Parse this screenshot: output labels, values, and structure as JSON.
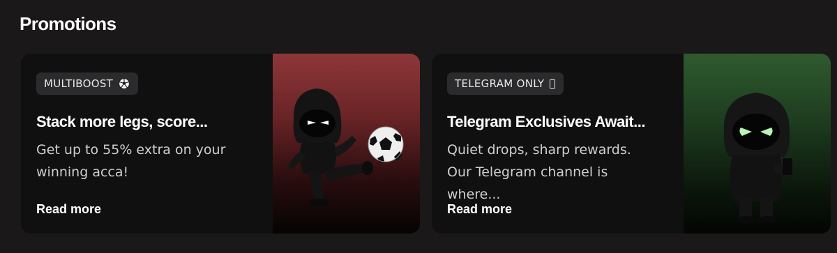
{
  "section": {
    "title": "Promotions"
  },
  "cards": [
    {
      "badge": "MULTIBOOST",
      "badge_icon": "soccer-ball-icon",
      "title": "Stack more legs, score...",
      "description": "Get up to 55% extra on your winning acca!",
      "link": "Read more",
      "image_theme": "red",
      "accent": "#8e3639"
    },
    {
      "badge": "TELEGRAM ONLY",
      "badge_icon": "telegram-icon",
      "title": "Telegram Exclusives Await...",
      "description": "Quiet drops, sharp rewards. Our Telegram channel is where...",
      "link": "Read more",
      "image_theme": "green",
      "accent": "#2f5a2f"
    }
  ]
}
